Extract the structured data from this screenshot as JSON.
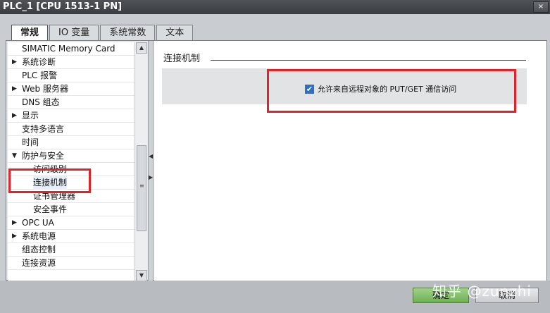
{
  "window": {
    "title": "PLC_1 [CPU 1513-1 PN]",
    "close_label": "×"
  },
  "tabs": [
    {
      "label": "常规",
      "active": true
    },
    {
      "label": "IO 变量"
    },
    {
      "label": "系统常数"
    },
    {
      "label": "文本"
    }
  ],
  "tree": {
    "items": [
      {
        "label": "SIMATIC Memory Card",
        "arrow": ""
      },
      {
        "label": "系统诊断",
        "arrow": "▶"
      },
      {
        "label": "PLC 报警",
        "arrow": ""
      },
      {
        "label": "Web 服务器",
        "arrow": "▶"
      },
      {
        "label": "DNS 组态",
        "arrow": ""
      },
      {
        "label": "显示",
        "arrow": "▶"
      },
      {
        "label": "支持多语言",
        "arrow": ""
      },
      {
        "label": "时间",
        "arrow": ""
      },
      {
        "label": "防护与安全",
        "arrow": "▼"
      },
      {
        "label": "访问级别",
        "arrow": ""
      },
      {
        "label": "连接机制",
        "arrow": ""
      },
      {
        "label": "证书管理器",
        "arrow": ""
      },
      {
        "label": "安全事件",
        "arrow": ""
      },
      {
        "label": "OPC UA",
        "arrow": "▶"
      },
      {
        "label": "系统电源",
        "arrow": "▶"
      },
      {
        "label": "组态控制",
        "arrow": ""
      },
      {
        "label": "连接资源",
        "arrow": ""
      }
    ]
  },
  "main": {
    "section_title": "连接机制",
    "checkbox_label": "允许来自远程对象的 PUT/GET 通信访问",
    "checkbox_checked": true
  },
  "footer": {
    "ok_label": "确定",
    "cancel_label": "取消"
  },
  "watermark": "知乎 @zunzhi",
  "colors": {
    "highlight": "#e0222a",
    "accent": "#2a6fc9"
  }
}
